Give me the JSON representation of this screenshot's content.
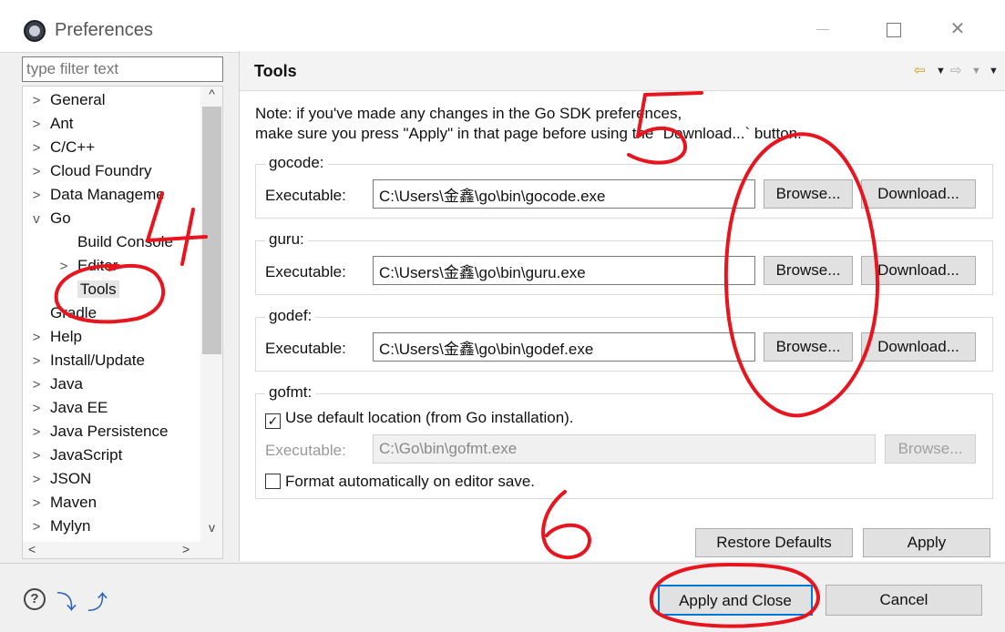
{
  "window": {
    "title": "Preferences",
    "icons": {
      "app": "eclipse-icon",
      "minimize": "minimize-icon",
      "maximize": "maximize-icon",
      "close": "close-icon"
    }
  },
  "nav": {
    "filter_placeholder": "type filter text",
    "items": [
      {
        "label": "General",
        "arrow": ">"
      },
      {
        "label": "Ant",
        "arrow": ">"
      },
      {
        "label": "C/C++",
        "arrow": ">"
      },
      {
        "label": "Cloud Foundry",
        "arrow": ">"
      },
      {
        "label": "Data Manageme",
        "arrow": ">"
      },
      {
        "label": "Go",
        "arrow": "v"
      },
      {
        "label": "Build Console",
        "arrow": ""
      },
      {
        "label": "Editor",
        "arrow": ">"
      },
      {
        "label": "Tools",
        "arrow": "",
        "selected": true
      },
      {
        "label": "Gradle",
        "arrow": ""
      },
      {
        "label": "Help",
        "arrow": ">"
      },
      {
        "label": "Install/Update",
        "arrow": ">"
      },
      {
        "label": "Java",
        "arrow": ">"
      },
      {
        "label": "Java EE",
        "arrow": ">"
      },
      {
        "label": "Java Persistence",
        "arrow": ">"
      },
      {
        "label": "JavaScript",
        "arrow": ">"
      },
      {
        "label": "JSON",
        "arrow": ">"
      },
      {
        "label": "Maven",
        "arrow": ">"
      },
      {
        "label": "Mylyn",
        "arrow": ">"
      }
    ],
    "scroll_up": "^",
    "scroll_down": "v",
    "scroll_left": "<",
    "scroll_right": ">"
  },
  "panel": {
    "title": "Tools",
    "history": {
      "back": "⇦",
      "back_menu": "▼",
      "forward": "⇨",
      "forward_menu": "▼",
      "view_menu": "▼"
    },
    "note_line1": "Note: if you've made any changes in the Go SDK preferences,",
    "note_line2": "make sure you press \"Apply\" in that page before using the `Download...` button.",
    "executable_label": "Executable:",
    "browse_label": "Browse...",
    "download_label": "Download...",
    "gocode": {
      "label": "gocode:",
      "path": "C:\\Users\\金鑫\\go\\bin\\gocode.exe"
    },
    "guru": {
      "label": "guru:",
      "path": "C:\\Users\\金鑫\\go\\bin\\guru.exe"
    },
    "godef": {
      "label": "godef:",
      "path": "C:\\Users\\金鑫\\go\\bin\\godef.exe"
    },
    "gofmt": {
      "label": "gofmt:",
      "use_default_label": "Use default location (from Go installation).",
      "use_default_checked": true,
      "check_mark": "✓",
      "path": "C:\\Go\\bin\\gofmt.exe",
      "format_on_save_label": "Format automatically on editor save.",
      "format_on_save_checked": false
    },
    "restore_defaults_label": "Restore Defaults",
    "apply_label": "Apply"
  },
  "footer": {
    "help_glyph": "?",
    "import_glyph": "⤵",
    "export_glyph": "⤴",
    "apply_close_label": "Apply and Close",
    "cancel_label": "Cancel"
  },
  "annotations": {
    "color": "#e8141e",
    "marks": [
      "4",
      "5",
      "6"
    ]
  }
}
